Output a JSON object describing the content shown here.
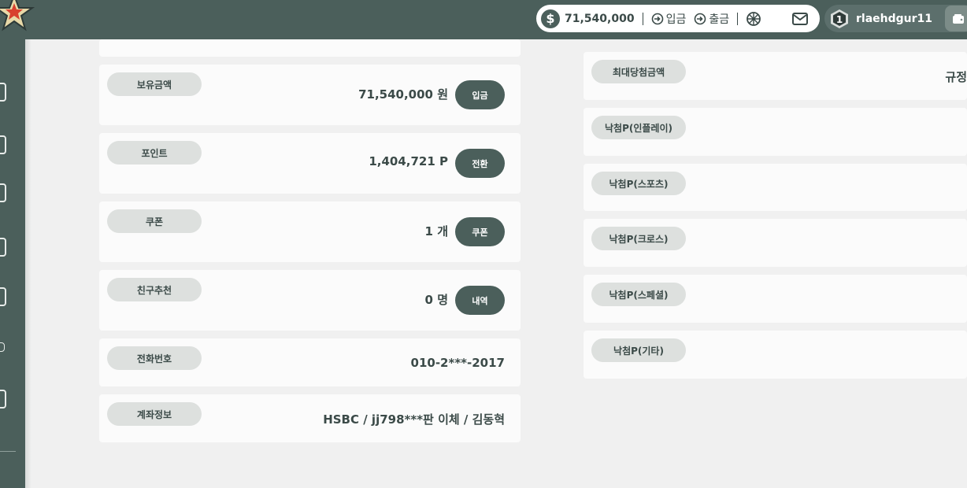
{
  "header": {
    "balance": "71,540,000",
    "deposit_label": "입금",
    "withdraw_label": "출금",
    "level": "1",
    "username": "rlaehdgur11"
  },
  "left_cards": [
    {
      "label": "보유금액",
      "value": "71,540,000 원",
      "action": "입금"
    },
    {
      "label": "포인트",
      "value": "1,404,721 P",
      "action": "전환"
    },
    {
      "label": "쿠폰",
      "value": "1 개",
      "action": "쿠폰"
    },
    {
      "label": "친구추천",
      "value": "0 명",
      "action": "내역"
    },
    {
      "label": "전화번호",
      "value": "010-2***-2017"
    },
    {
      "label": "계좌정보",
      "value": "HSBC / jj798***판 이체 / 김동혁"
    }
  ],
  "right_cards": [
    {
      "label": "최대당첨금액",
      "value": "규정"
    },
    {
      "label": "낙첨P(인플레이)"
    },
    {
      "label": "낙첨P(스포츠)"
    },
    {
      "label": "낙첨P(크로스)"
    },
    {
      "label": "낙첨P(스페셜)"
    },
    {
      "label": "낙첨P(기타)"
    }
  ],
  "colors": {
    "primary": "#4b5f5b",
    "background": "#f0f0f0",
    "card": "#fbfbfb",
    "pill": "#dde0de"
  },
  "icons": [
    "star-logo-icon",
    "dollar-icon",
    "login-icon",
    "wheel-icon",
    "mail-icon",
    "level-badge-icon",
    "wallet-icon"
  ]
}
